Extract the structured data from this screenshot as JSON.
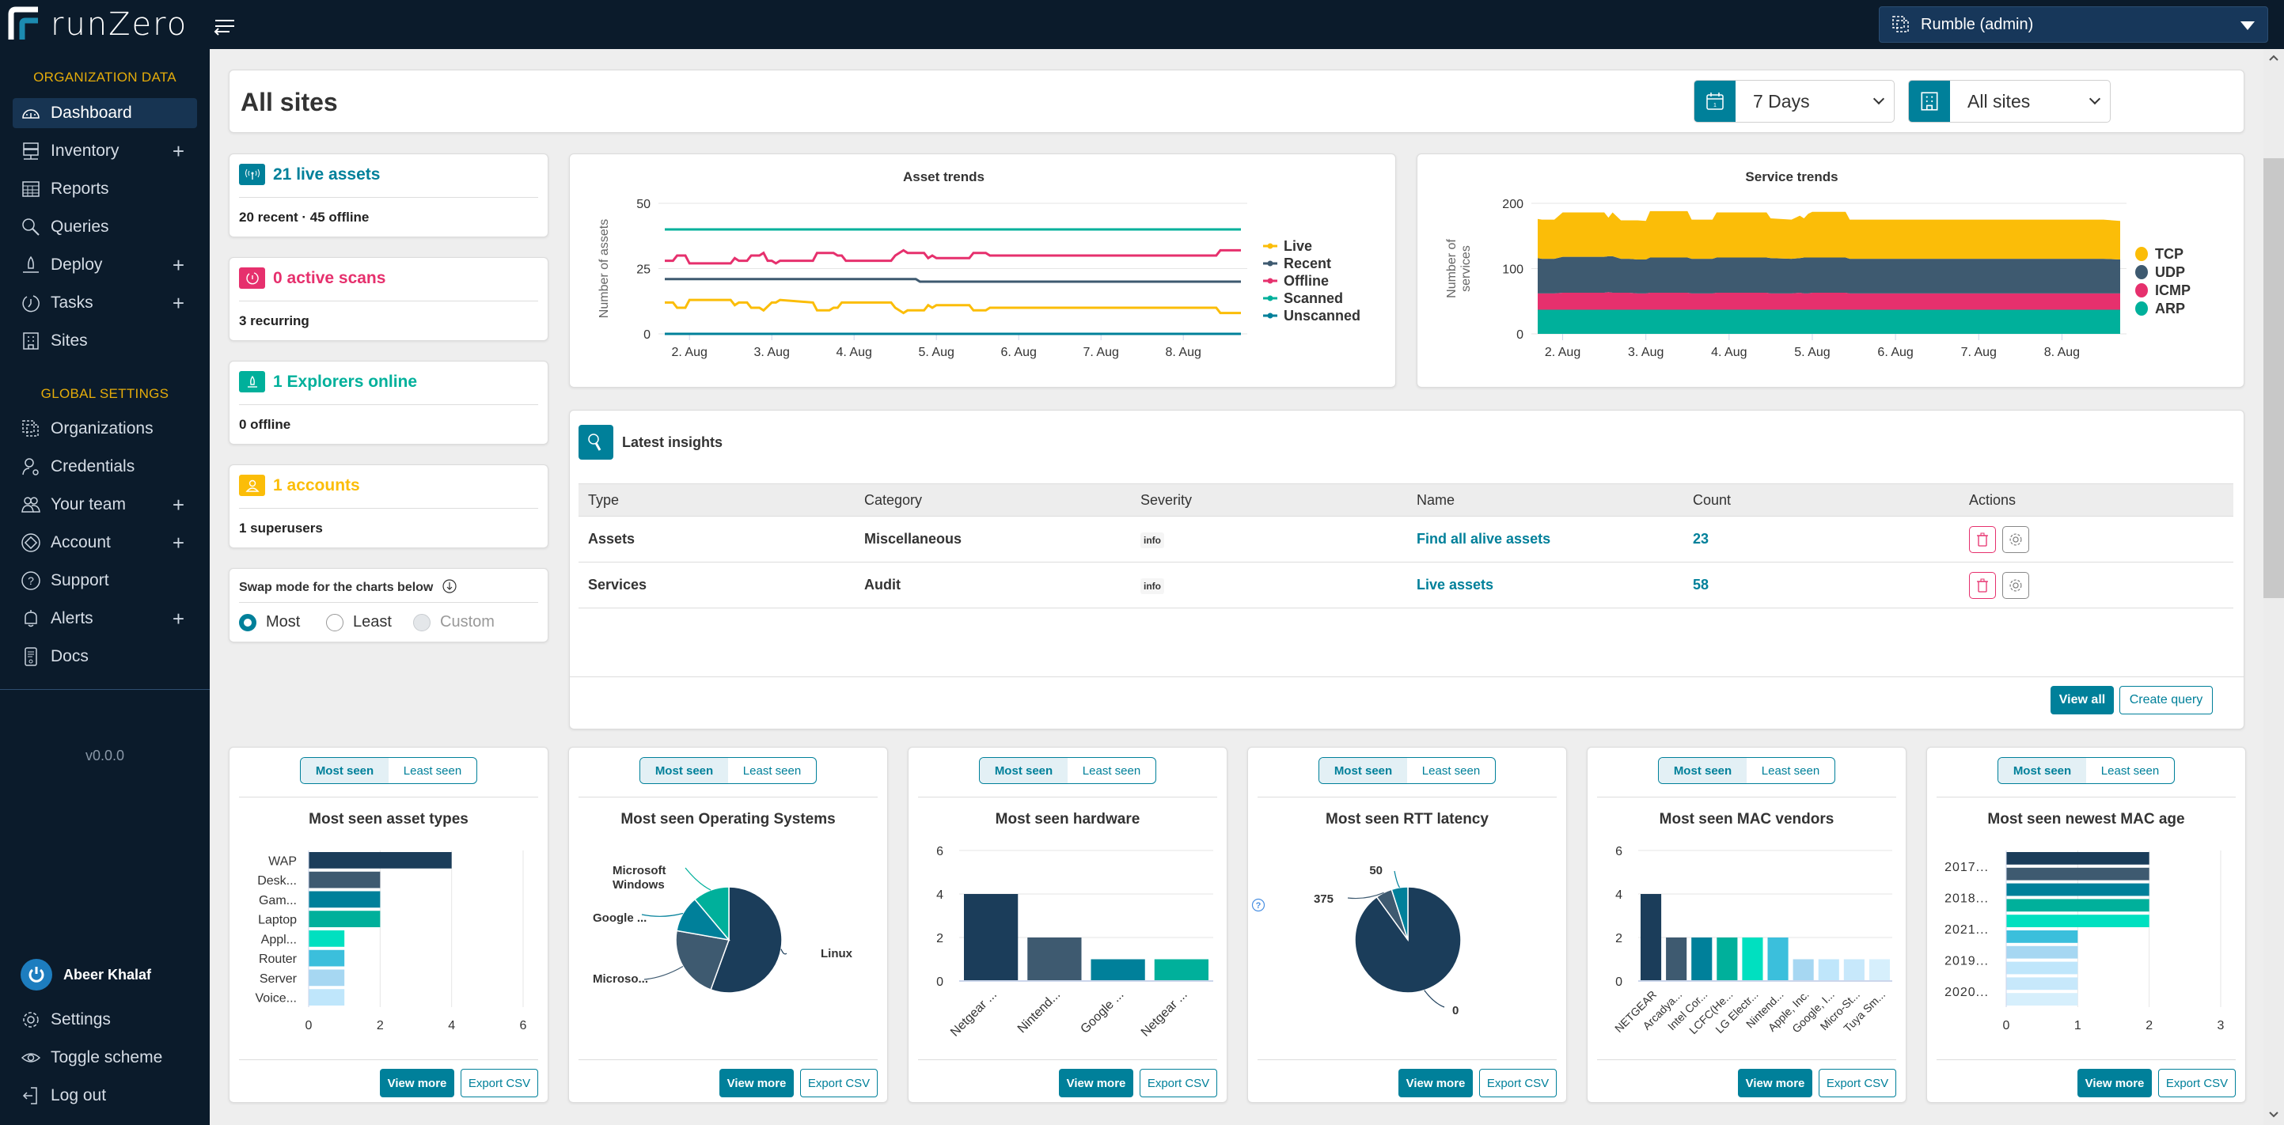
{
  "topbar": {
    "brand": "runZero",
    "org_selector": "Rumble (admin)"
  },
  "sidebar": {
    "section_org": "ORGANIZATION DATA",
    "org_items": [
      {
        "label": "Dashboard",
        "icon": "dashboard-gauge-icon",
        "expandable": false,
        "active": true
      },
      {
        "label": "Inventory",
        "icon": "server-icon",
        "expandable": true
      },
      {
        "label": "Reports",
        "icon": "table-grid-icon",
        "expandable": false
      },
      {
        "label": "Queries",
        "icon": "search-icon",
        "expandable": false
      },
      {
        "label": "Deploy",
        "icon": "rocket-icon",
        "expandable": true
      },
      {
        "label": "Tasks",
        "icon": "timer-icon",
        "expandable": true
      },
      {
        "label": "Sites",
        "icon": "building-icon",
        "expandable": false
      }
    ],
    "section_global": "GLOBAL SETTINGS",
    "global_items": [
      {
        "label": "Organizations",
        "icon": "organizations-icon",
        "expandable": false
      },
      {
        "label": "Credentials",
        "icon": "user-key-icon",
        "expandable": false
      },
      {
        "label": "Your team",
        "icon": "team-icon",
        "expandable": true
      },
      {
        "label": "Account",
        "icon": "account-diamond-icon",
        "expandable": true
      },
      {
        "label": "Support",
        "icon": "help-circle-icon",
        "expandable": false
      },
      {
        "label": "Alerts",
        "icon": "bell-icon",
        "expandable": true
      },
      {
        "label": "Docs",
        "icon": "document-icon",
        "expandable": false
      }
    ],
    "version": "v0.0.0",
    "user_name": "Abeer Khalaf",
    "bottom_items": [
      {
        "label": "Settings",
        "icon": "gear-icon"
      },
      {
        "label": "Toggle scheme",
        "icon": "eye-icon"
      },
      {
        "label": "Log out",
        "icon": "logout-icon"
      }
    ]
  },
  "header": {
    "title": "All sites",
    "time_filter": "7 Days",
    "site_filter": "All sites"
  },
  "stats": [
    {
      "title": "21 live assets",
      "subtitle": "20 recent · 45 offline",
      "color": "#00809a",
      "icon": "antenna-icon"
    },
    {
      "title": "0 active scans",
      "subtitle": "3 recurring",
      "color": "#e6306d",
      "icon": "timer-icon"
    },
    {
      "title": "1 Explorers online",
      "subtitle": "0 offline",
      "color": "#00b09b",
      "icon": "rocket-icon"
    },
    {
      "title": "1 accounts",
      "subtitle": "1 superusers",
      "color": "#fbbd08",
      "icon": "user-icon"
    }
  ],
  "swap_mode": {
    "label": "Swap mode for the charts below",
    "options": [
      "Most",
      "Least",
      "Custom"
    ],
    "selected": "Most",
    "disabled": [
      "Custom"
    ]
  },
  "insights": {
    "title": "Latest insights",
    "columns": [
      "Type",
      "Category",
      "Severity",
      "Name",
      "Count",
      "Actions"
    ],
    "rows": [
      {
        "type": "Assets",
        "category": "Miscellaneous",
        "severity": "info",
        "name": "Find all alive assets",
        "count": "23"
      },
      {
        "type": "Services",
        "category": "Audit",
        "severity": "info",
        "name": "Live assets",
        "count": "58"
      }
    ],
    "view_all": "View all",
    "create_query": "Create query"
  },
  "widget_buttons": {
    "most_seen": "Most seen",
    "least_seen": "Least seen",
    "view_more": "View more",
    "export_csv": "Export CSV"
  },
  "chart_data": [
    {
      "id": "asset-trends",
      "type": "line",
      "title": "Asset trends",
      "xlabel": "",
      "ylabel": "Number of assets",
      "ylim": [
        0,
        50
      ],
      "yticks": [
        0,
        25,
        50
      ],
      "x_ticks": [
        "2. Aug",
        "3. Aug",
        "4. Aug",
        "5. Aug",
        "6. Aug",
        "7. Aug",
        "8. Aug"
      ],
      "x_range": [
        1.7,
        8.7
      ],
      "legend": "right",
      "series": [
        {
          "name": "Live",
          "color": "#fbbd08",
          "x": [
            1.7,
            1.8,
            1.85,
            1.95,
            2.0,
            2.1,
            2.5,
            2.55,
            2.6,
            2.7,
            2.75,
            2.85,
            2.9,
            3.0,
            3.05,
            3.1,
            3.5,
            3.55,
            3.7,
            3.75,
            3.8,
            3.85,
            4.45,
            4.5,
            4.6,
            4.65,
            4.85,
            4.9,
            4.95,
            5.0,
            5.4,
            5.45,
            5.6,
            5.65,
            8.4,
            8.45,
            8.7
          ],
          "y": [
            12,
            12,
            10,
            10,
            13,
            13,
            13,
            11,
            12,
            12,
            10,
            10,
            9,
            12,
            12,
            13,
            12,
            9,
            9,
            10,
            10,
            12,
            12,
            10,
            8,
            9,
            9,
            11,
            10,
            11,
            11,
            9,
            9,
            10,
            10,
            8,
            8
          ]
        },
        {
          "name": "Recent",
          "color": "#3e5a70",
          "x": [
            1.7,
            4.75,
            4.8,
            8.7
          ],
          "y": [
            21,
            21,
            20,
            20
          ]
        },
        {
          "name": "Offline",
          "color": "#e6306d",
          "x": [
            1.7,
            1.8,
            1.85,
            1.95,
            2.0,
            2.5,
            2.55,
            2.6,
            2.7,
            2.75,
            2.85,
            2.9,
            2.95,
            3.0,
            3.05,
            3.1,
            3.5,
            3.55,
            3.75,
            3.8,
            3.85,
            3.9,
            4.45,
            4.5,
            4.6,
            4.65,
            4.85,
            4.9,
            4.95,
            5.0,
            5.4,
            5.45,
            5.6,
            5.65,
            8.4,
            8.45,
            8.7
          ],
          "y": [
            28,
            28,
            30,
            30,
            27,
            27,
            29,
            28,
            28,
            30,
            30,
            31,
            28,
            28,
            27,
            28,
            28,
            31,
            31,
            30,
            30,
            28,
            28,
            30,
            32,
            31,
            31,
            29,
            30,
            29,
            29,
            31,
            31,
            30,
            30,
            32,
            32
          ]
        },
        {
          "name": "Scanned",
          "color": "#00b09b",
          "x": [
            1.7,
            8.7
          ],
          "y": [
            40,
            40
          ]
        },
        {
          "name": "Unscanned",
          "color": "#00809a",
          "x": [
            1.7,
            8.7
          ],
          "y": [
            0,
            0
          ]
        }
      ]
    },
    {
      "id": "service-trends",
      "type": "area",
      "stacked": true,
      "title": "Service trends",
      "xlabel": "",
      "ylabel": "Number of services",
      "ylim": [
        0,
        200
      ],
      "yticks": [
        0,
        100,
        200
      ],
      "x_ticks": [
        "2. Aug",
        "3. Aug",
        "4. Aug",
        "5. Aug",
        "6. Aug",
        "7. Aug",
        "8. Aug"
      ],
      "x_range": [
        1.7,
        8.7
      ],
      "legend": "right",
      "x": [
        1.7,
        1.75,
        1.9,
        2.0,
        2.5,
        2.55,
        2.6,
        2.7,
        2.8,
        2.9,
        3.0,
        3.05,
        3.5,
        3.55,
        3.8,
        3.85,
        4.45,
        4.5,
        4.75,
        4.85,
        4.9,
        4.95,
        5.0,
        5.4,
        5.45,
        8.5,
        8.7
      ],
      "series": [
        {
          "name": "ARP",
          "color": "#00b09b",
          "values": [
            37,
            37,
            37,
            37,
            37,
            37,
            37,
            37,
            37,
            37,
            37,
            37,
            37,
            37,
            37,
            37,
            37,
            37,
            37,
            37,
            37,
            37,
            37,
            37,
            37,
            37,
            37
          ]
        },
        {
          "name": "ICMP",
          "color": "#e6306d",
          "values": [
            25,
            25,
            25,
            26,
            26,
            27,
            26,
            26,
            26,
            25,
            25,
            26,
            26,
            25,
            25,
            26,
            26,
            25,
            25,
            26,
            25,
            25,
            26,
            26,
            25,
            25,
            25
          ]
        },
        {
          "name": "UDP",
          "color": "#3e5a70",
          "values": [
            54,
            53,
            53,
            55,
            55,
            55,
            56,
            52,
            52,
            52,
            52,
            54,
            54,
            53,
            53,
            54,
            54,
            54,
            53,
            53,
            55,
            55,
            54,
            54,
            53,
            53,
            52
          ]
        },
        {
          "name": "TCP",
          "color": "#fbbd08",
          "values": [
            60,
            60,
            60,
            68,
            68,
            59,
            67,
            59,
            59,
            60,
            59,
            71,
            71,
            60,
            60,
            69,
            69,
            61,
            60,
            65,
            60,
            67,
            70,
            70,
            60,
            60,
            59
          ]
        }
      ]
    },
    {
      "id": "asset-types",
      "type": "bar",
      "orientation": "horizontal",
      "title": "Most seen asset types",
      "categories": [
        "WAP",
        "Desk...",
        "Gam...",
        "Laptop",
        "Appl...",
        "Router",
        "Server",
        "Voice..."
      ],
      "values": [
        4,
        2,
        2,
        2,
        1,
        1,
        1,
        1
      ],
      "colors": [
        "#1b3d5a",
        "#3e5a70",
        "#00809a",
        "#00b09b",
        "#00e0c0",
        "#3bbfdc",
        "#a6d7f2",
        "#bfe6fb"
      ],
      "xlim": [
        0,
        6
      ],
      "xticks": [
        0,
        2,
        4,
        6
      ]
    },
    {
      "id": "operating-systems",
      "type": "pie",
      "title": "Most seen Operating Systems",
      "labels": [
        "Linux",
        "Microso...",
        "Google ...",
        "Microsoft Windows"
      ],
      "values": [
        5,
        2,
        1,
        1
      ],
      "colors": [
        "#1b3d5a",
        "#3e5a70",
        "#00809a",
        "#00b09b"
      ]
    },
    {
      "id": "hardware",
      "type": "bar",
      "orientation": "vertical",
      "title": "Most seen hardware",
      "categories": [
        "Netgear ...",
        "Nintend...",
        "Google ...",
        "Netgear ..."
      ],
      "values": [
        4,
        2,
        1,
        1
      ],
      "colors": [
        "#1b3d5a",
        "#3e5a70",
        "#00809a",
        "#00b09b"
      ],
      "ylim": [
        0,
        6
      ],
      "yticks": [
        0,
        2,
        4,
        6
      ]
    },
    {
      "id": "rtt-latency",
      "type": "pie",
      "title": "Most seen RTT latency",
      "labels": [
        "0",
        "375",
        "50"
      ],
      "values": [
        18,
        1,
        1
      ],
      "colors": [
        "#1b3d5a",
        "#3e5a70",
        "#00809a"
      ]
    },
    {
      "id": "mac-vendors",
      "type": "bar",
      "orientation": "vertical",
      "title": "Most seen MAC vendors",
      "categories": [
        "NETGEAR",
        "Arcadya...",
        "Intel Cor...",
        "LCFC(He...",
        "LG Electr...",
        "Nintend...",
        "Apple, Inc.",
        "Google, I...",
        "Micro-St...",
        "Tuya Sm..."
      ],
      "values": [
        4,
        2,
        2,
        2,
        2,
        2,
        1,
        1,
        1,
        1
      ],
      "colors": [
        "#1b3d5a",
        "#3e5a70",
        "#00809a",
        "#00b09b",
        "#00e0c0",
        "#3bbfdc",
        "#a6d7f2",
        "#bfe6fb",
        "#c7e8fb",
        "#d6effc"
      ],
      "ylim": [
        0,
        6
      ],
      "yticks": [
        0,
        2,
        4,
        6
      ]
    },
    {
      "id": "newest-mac-age",
      "type": "bar",
      "orientation": "horizontal",
      "title": "Most seen newest MAC age",
      "categories": [
        "2017...",
        "",
        "2018...",
        "",
        "2021...",
        "",
        "2019...",
        "",
        "2020...",
        ""
      ],
      "values": [
        2,
        2,
        2,
        2,
        2,
        1,
        1,
        1,
        1,
        1
      ],
      "colors": [
        "#1b3d5a",
        "#3e5a70",
        "#00809a",
        "#00b09b",
        "#00e0c0",
        "#3bbfdc",
        "#a6d7f2",
        "#bfe6fb",
        "#c7e8fb",
        "#d6effc"
      ],
      "xlim": [
        0,
        3
      ],
      "xticks": [
        0,
        1,
        2,
        3
      ]
    }
  ]
}
